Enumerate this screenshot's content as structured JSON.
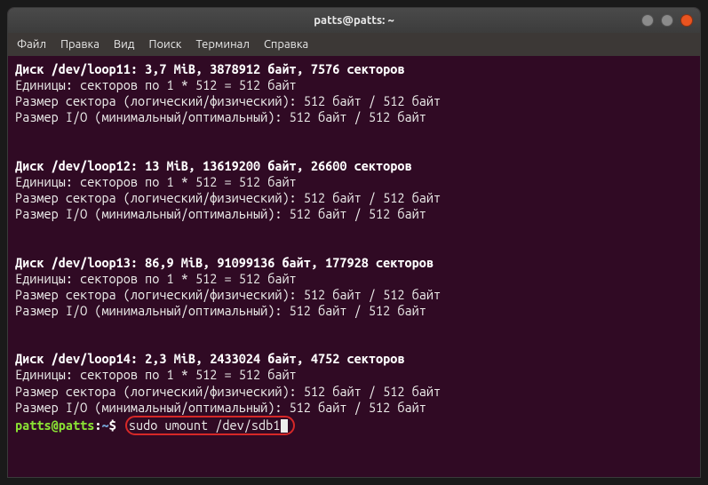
{
  "titlebar": {
    "title": "patts@patts: ~"
  },
  "menubar": {
    "items": [
      "Файл",
      "Правка",
      "Вид",
      "Поиск",
      "Терминал",
      "Справка"
    ]
  },
  "blocks": [
    {
      "header": "Диск /dev/loop11: 3,7 MiB, 3878912 байт, 7576 секторов",
      "lines": [
        "Единицы: секторов по 1 * 512 = 512 байт",
        "Размер сектора (логический/физический): 512 байт / 512 байт",
        "Размер I/O (минимальный/оптимальный): 512 байт / 512 байт"
      ]
    },
    {
      "header": "Диск /dev/loop12: 13 MiB, 13619200 байт, 26600 секторов",
      "lines": [
        "Единицы: секторов по 1 * 512 = 512 байт",
        "Размер сектора (логический/физический): 512 байт / 512 байт",
        "Размер I/O (минимальный/оптимальный): 512 байт / 512 байт"
      ]
    },
    {
      "header": "Диск /dev/loop13: 86,9 MiB, 91099136 байт, 177928 секторов",
      "lines": [
        "Единицы: секторов по 1 * 512 = 512 байт",
        "Размер сектора (логический/физический): 512 байт / 512 байт",
        "Размер I/O (минимальный/оптимальный): 512 байт / 512 байт"
      ]
    },
    {
      "header": "Диск /dev/loop14: 2,3 MiB, 2433024 байт, 4752 секторов",
      "lines": [
        "Единицы: секторов по 1 * 512 = 512 байт",
        "Размер сектора (логический/физический): 512 байт / 512 байт",
        "Размер I/O (минимальный/оптимальный): 512 байт / 512 байт"
      ]
    }
  ],
  "prompt": {
    "user_host": "patts@patts",
    "colon": ":",
    "path": "~",
    "dollar": "$",
    "command": "sudo umount /dev/sdb1"
  }
}
